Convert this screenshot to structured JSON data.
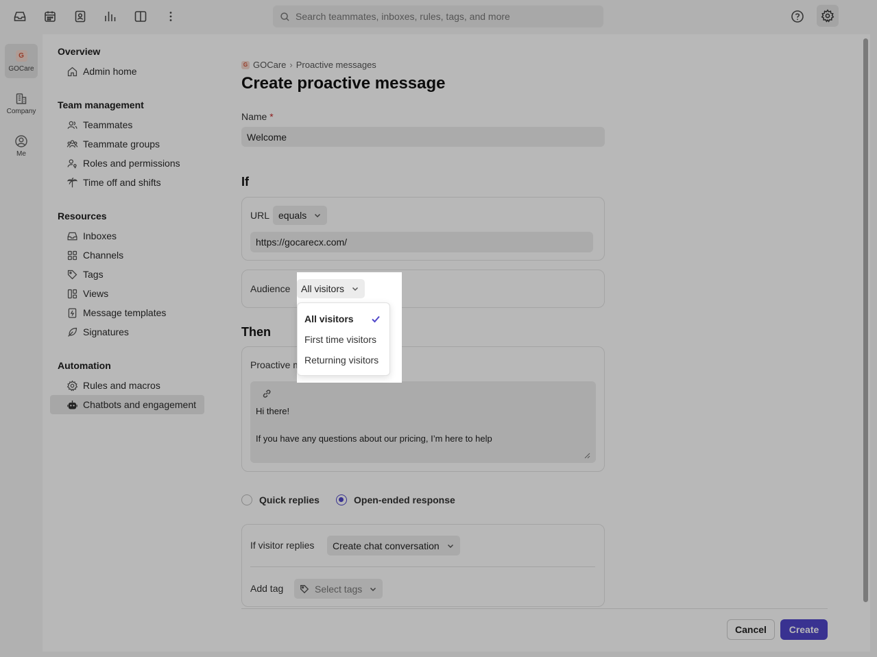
{
  "topbar": {
    "search_placeholder": "Search teammates, inboxes, rules, tags, and more",
    "icons": [
      "inbox-icon",
      "calendar-icon",
      "contacts-icon",
      "analytics-icon",
      "layout-icon",
      "more-icon",
      "help-icon",
      "settings-icon"
    ]
  },
  "rail": {
    "items": [
      {
        "label": "GOCare",
        "badge": "G"
      },
      {
        "label": "Company"
      },
      {
        "label": "Me"
      }
    ]
  },
  "sidebar": {
    "overview": {
      "title": "Overview",
      "items": [
        "Admin home"
      ]
    },
    "team": {
      "title": "Team management",
      "items": [
        "Teammates",
        "Teammate groups",
        "Roles and permissions",
        "Time off and shifts"
      ]
    },
    "resources": {
      "title": "Resources",
      "items": [
        "Inboxes",
        "Channels",
        "Tags",
        "Views",
        "Message templates",
        "Signatures"
      ]
    },
    "automation": {
      "title": "Automation",
      "items": [
        "Rules and macros",
        "Chatbots and engagement"
      ]
    }
  },
  "breadcrumb": {
    "badge": "G",
    "workspace": "GOCare",
    "sep": "›",
    "current": "Proactive messages"
  },
  "page_title": "Create proactive message",
  "form": {
    "name_label": "Name",
    "required_mark": "*",
    "name_value": "Welcome",
    "if_heading": "If",
    "url_label": "URL",
    "url_operator": "equals",
    "url_value": "https://gocarecx.com/",
    "audience_label": "Audience",
    "audience_value": "All visitors",
    "then_heading": "Then",
    "proactive_label_partial": "Proactive m",
    "message_text": "Hi there!\n\nIf you have any questions about our pricing, I’m here to help",
    "quick_replies_label": "Quick replies",
    "open_ended_label": "Open-ended response",
    "selected_response": "Open-ended response",
    "visitor_replies_label": "If visitor replies",
    "visitor_replies_value": "Create chat conversation",
    "add_tag_label": "Add tag",
    "tags_placeholder": "Select tags"
  },
  "audience_menu": {
    "options": [
      "All visitors",
      "First time visitors",
      "Returning visitors"
    ],
    "selected": "All visitors"
  },
  "footer": {
    "cancel_label": "Cancel",
    "create_label": "Create"
  },
  "colors": {
    "accent": "#4f46c9",
    "required": "#c62828",
    "brand_badge": "#d0533a"
  }
}
